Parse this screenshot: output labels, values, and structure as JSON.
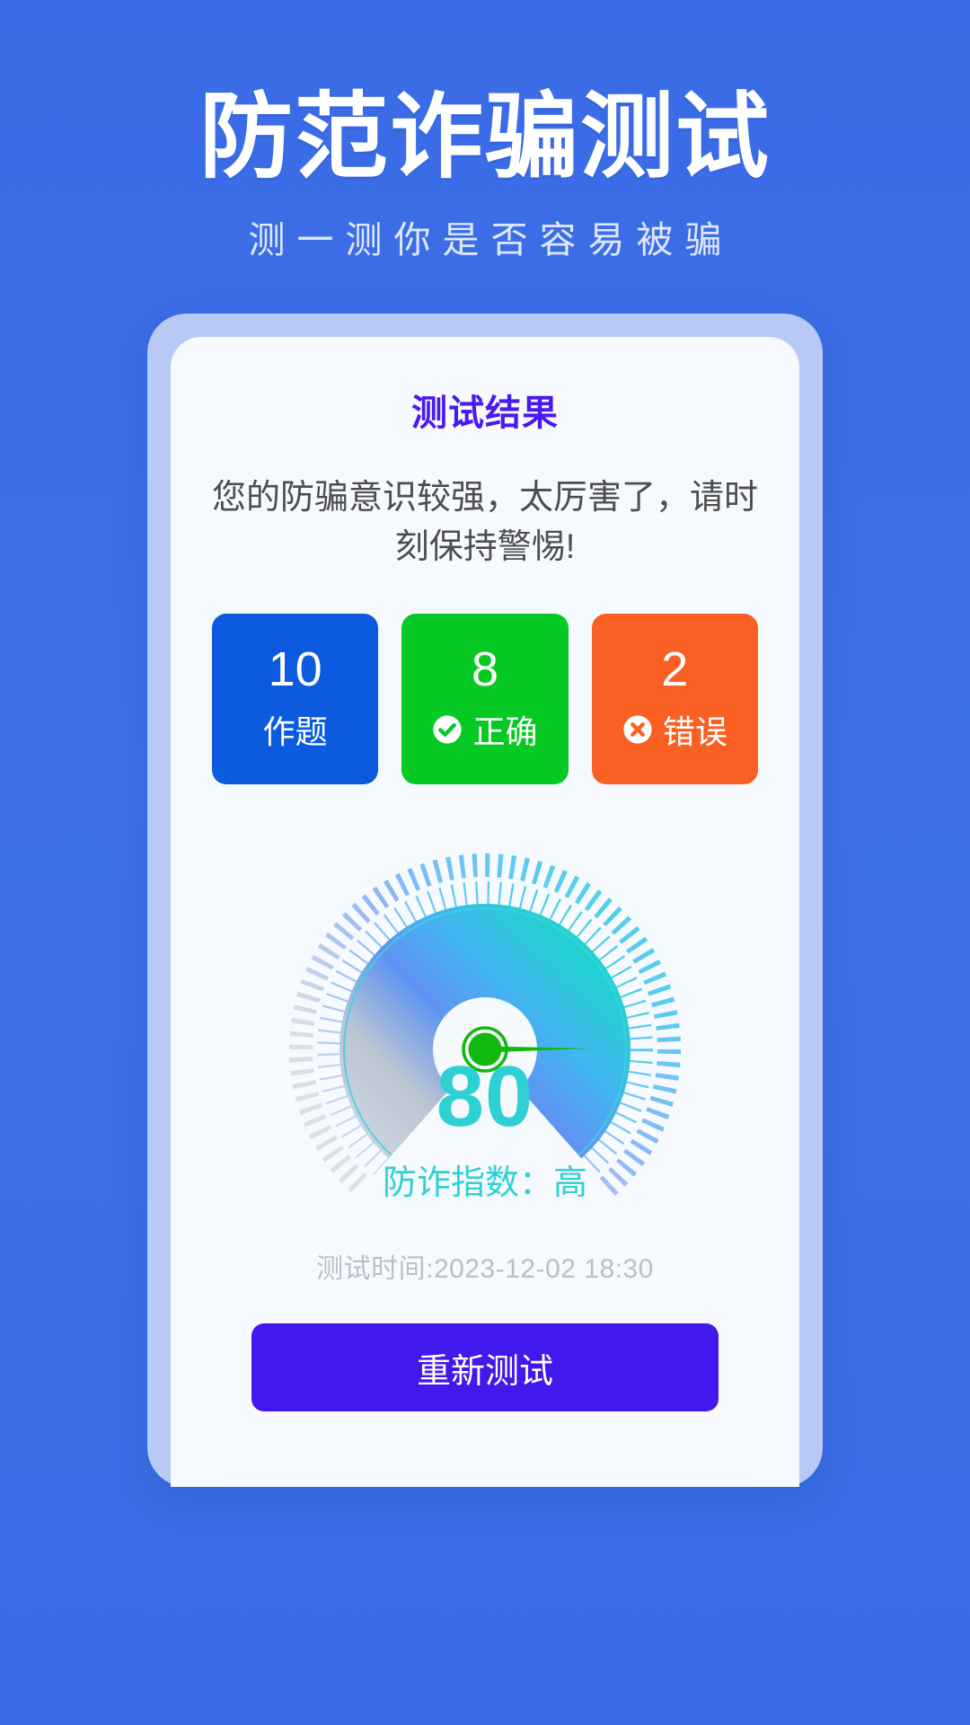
{
  "header": {
    "title": "防范诈骗测试",
    "subtitle": "测一测你是否容易被骗"
  },
  "card": {
    "title": "测试结果",
    "description": "您的防骗意识较强，太厉害了，请时刻保持警惕!",
    "stats": [
      {
        "value": "10",
        "label": "作题",
        "icon": "",
        "color": "#0b5ae0"
      },
      {
        "value": "8",
        "label": "正确",
        "icon": "check-circle-icon",
        "color": "#07c924"
      },
      {
        "value": "2",
        "label": "错误",
        "icon": "x-circle-icon",
        "color": "#fa6024"
      }
    ],
    "gauge": {
      "score": "80",
      "score_label": "防诈指数：高",
      "min": 0,
      "max": 100,
      "value": 80,
      "score_color": "#2fd0d4",
      "needle_color": "#11b80e",
      "arc_start_color": "#c3ccd6",
      "arc_mid_color": "#4f8ef7",
      "arc_end_color": "#2ddcd8"
    },
    "timestamp": "测试时间:2023-12-02 18:30",
    "retest_button": "重新测试"
  },
  "colors": {
    "page_bg": "#3d6fe8",
    "card_border": "#b9c9f6",
    "card_bg": "#f6fafe",
    "accent": "#4a19ef"
  }
}
